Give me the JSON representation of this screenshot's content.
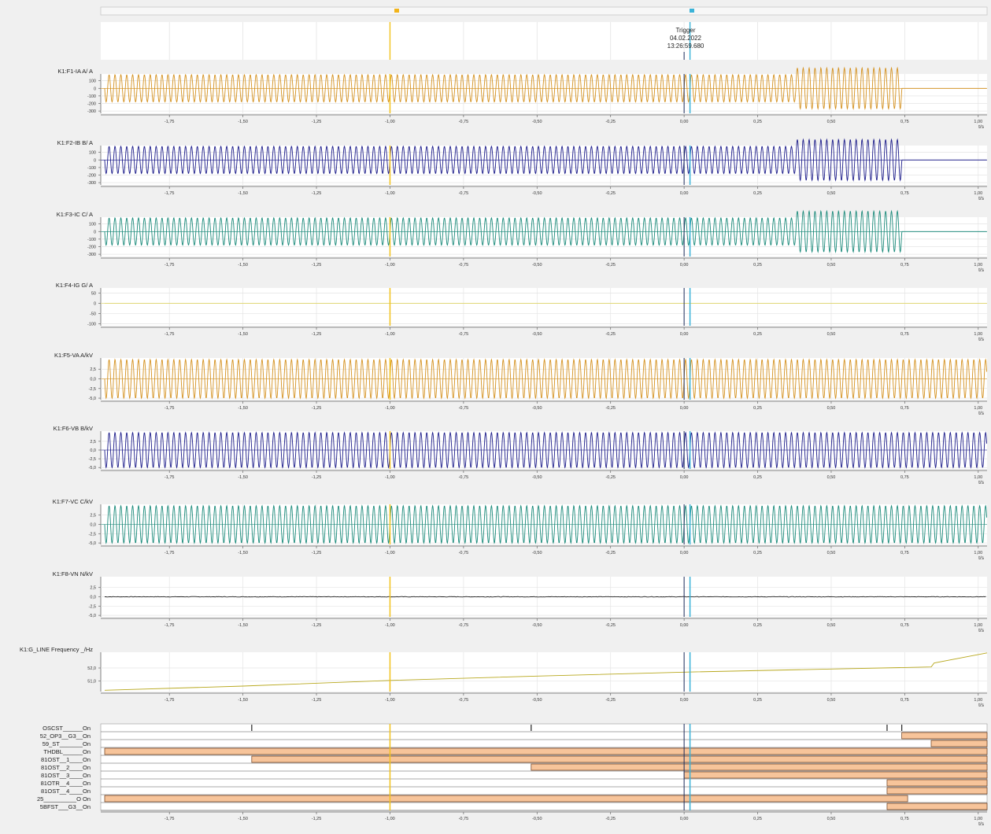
{
  "trigger": {
    "title": "Trigger",
    "date": "04.02.2022",
    "time": "13:26:59.680"
  },
  "colors": {
    "cursor_a": "#f2c21b",
    "cursor_b": "#3bb3d8",
    "trigger_line": "#1a2a5a",
    "phase_a": "#d4911f",
    "phase_b": "#1c1c8a",
    "phase_c": "#1a8a7a",
    "ground": "#e0d770",
    "neutral": "#222222",
    "frequency": "#b8a81e",
    "digital_on": "#f7c49a",
    "grid": "#e4e4e4"
  },
  "time_axis": {
    "unit": "t/s",
    "xlim": [
      -1.97,
      1.03
    ],
    "ticks": [
      -1.75,
      -1.5,
      -1.25,
      -1.0,
      -0.75,
      -0.5,
      -0.25,
      0.0,
      0.25,
      0.5,
      0.75,
      1.0
    ],
    "tick_labels": [
      "-1,75",
      "-1,50",
      "-1,25",
      "-1,00",
      "-0,75",
      "-0,50",
      "-0,25",
      "0,00",
      "0,25",
      "0,50",
      "0,75",
      "1,00"
    ],
    "cursor_a_t": -1.0,
    "cursor_b_t": 0.02,
    "trigger_t": 0.0
  },
  "chart_data": [
    {
      "type": "line",
      "title": "K1:F1-IA A/ A",
      "ytick_labels": [
        "100",
        "0",
        "-100",
        "-200",
        "-300"
      ],
      "yticks": [
        100,
        0,
        -100,
        -200,
        -300
      ],
      "ylim": [
        -330,
        190
      ],
      "color": "phase_a",
      "waveform": {
        "kind": "sine",
        "freq_hz": 50,
        "segments": [
          {
            "t_start": -1.97,
            "t_end": 0.38,
            "amplitude": 180
          },
          {
            "t_start": 0.38,
            "t_end": 0.74,
            "amplitude": 270
          },
          {
            "t_start": 0.74,
            "t_end": 1.03,
            "amplitude": 0
          }
        ]
      }
    },
    {
      "type": "line",
      "title": "K1:F2-IB B/ A",
      "ytick_labels": [
        "100",
        "0",
        "-100",
        "-200",
        "-300"
      ],
      "yticks": [
        100,
        0,
        -100,
        -200,
        -300
      ],
      "ylim": [
        -330,
        190
      ],
      "color": "phase_b",
      "waveform": {
        "kind": "sine",
        "freq_hz": 50,
        "segments": [
          {
            "t_start": -1.97,
            "t_end": 0.38,
            "amplitude": 180
          },
          {
            "t_start": 0.38,
            "t_end": 0.74,
            "amplitude": 270
          },
          {
            "t_start": 0.74,
            "t_end": 1.03,
            "amplitude": 0
          }
        ]
      }
    },
    {
      "type": "line",
      "title": "K1:F3-IC C/ A",
      "ytick_labels": [
        "100",
        "0",
        "-100",
        "-200",
        "-300"
      ],
      "yticks": [
        100,
        0,
        -100,
        -200,
        -300
      ],
      "ylim": [
        -330,
        190
      ],
      "color": "phase_c",
      "waveform": {
        "kind": "sine",
        "freq_hz": 50,
        "segments": [
          {
            "t_start": -1.97,
            "t_end": 0.38,
            "amplitude": 180
          },
          {
            "t_start": 0.38,
            "t_end": 0.74,
            "amplitude": 270
          },
          {
            "t_start": 0.74,
            "t_end": 1.03,
            "amplitude": 0
          }
        ]
      }
    },
    {
      "type": "line",
      "title": "K1:F4-IG G/ A",
      "ytick_labels": [
        "50",
        "0",
        "-50",
        "-100"
      ],
      "yticks": [
        50,
        0,
        -50,
        -100
      ],
      "ylim": [
        -110,
        75
      ],
      "color": "ground",
      "waveform": {
        "kind": "flat",
        "value": 0
      }
    },
    {
      "type": "line",
      "title": "K1:F5-VA A/kV",
      "ytick_labels": [
        "2,5",
        "0,0",
        "-2,5",
        "-5,0"
      ],
      "yticks": [
        2.5,
        0,
        -2.5,
        -5.0
      ],
      "ylim": [
        -5.4,
        5.4
      ],
      "color": "phase_a",
      "waveform": {
        "kind": "sine",
        "freq_hz": 50,
        "segments": [
          {
            "t_start": -1.97,
            "t_end": 1.03,
            "amplitude": 5.0
          }
        ]
      }
    },
    {
      "type": "line",
      "title": "K1:F6-VB B/kV",
      "ytick_labels": [
        "2,5",
        "0,0",
        "-2,5",
        "-5,0"
      ],
      "yticks": [
        2.5,
        0,
        -2.5,
        -5.0
      ],
      "ylim": [
        -5.4,
        5.4
      ],
      "color": "phase_b",
      "waveform": {
        "kind": "sine",
        "freq_hz": 50,
        "segments": [
          {
            "t_start": -1.97,
            "t_end": 1.03,
            "amplitude": 5.0
          }
        ]
      }
    },
    {
      "type": "line",
      "title": "K1:F7-VC C/kV",
      "ytick_labels": [
        "2,5",
        "0,0",
        "-2,5",
        "-5,0"
      ],
      "yticks": [
        2.5,
        0,
        -2.5,
        -5.0
      ],
      "ylim": [
        -5.4,
        5.4
      ],
      "color": "phase_c",
      "waveform": {
        "kind": "sine",
        "freq_hz": 50,
        "segments": [
          {
            "t_start": -1.97,
            "t_end": 1.03,
            "amplitude": 5.0
          }
        ]
      }
    },
    {
      "type": "line",
      "title": "K1:F8-VN N/kV",
      "ytick_labels": [
        "2,5",
        "0,0",
        "-2,5",
        "-5,0"
      ],
      "yticks": [
        2.5,
        0,
        -2.5,
        -5.0
      ],
      "ylim": [
        -5.4,
        5.4
      ],
      "color": "neutral",
      "waveform": {
        "kind": "noise",
        "value": 0,
        "amplitude": 0.15
      }
    },
    {
      "type": "line",
      "title": "K1:G_LINE Frequency _/Hz",
      "ytick_labels": [
        "52,0",
        "51,0"
      ],
      "yticks": [
        52.0,
        51.0
      ],
      "ylim": [
        50.2,
        53.2
      ],
      "color": "frequency",
      "x": [
        -1.97,
        -1.5,
        -1.0,
        -0.5,
        0.0,
        0.5,
        0.84,
        0.85,
        1.03
      ],
      "y": [
        50.3,
        50.62,
        51.05,
        51.38,
        51.68,
        51.92,
        52.08,
        52.38,
        53.15
      ]
    },
    {
      "type": "timeline",
      "title": "",
      "color": "digital_on",
      "series": [
        {
          "name": "OSCST______On",
          "intervals": [],
          "marks": [
            -1.47,
            -0.52,
            0.69,
            0.74
          ]
        },
        {
          "name": "52_OP3__G3__On",
          "intervals": [
            [
              0.74,
              1.03
            ]
          ]
        },
        {
          "name": "59_ST_______On",
          "intervals": [
            [
              0.84,
              1.03
            ]
          ]
        },
        {
          "name": "THDBL______On",
          "intervals": [
            [
              -1.97,
              1.03
            ]
          ]
        },
        {
          "name": "81OST__1____On",
          "intervals": [
            [
              -1.47,
              1.03
            ]
          ]
        },
        {
          "name": "81OST__2____On",
          "intervals": [
            [
              -0.52,
              1.03
            ]
          ]
        },
        {
          "name": "81OST__3____On",
          "intervals": [
            [
              0.0,
              1.03
            ]
          ]
        },
        {
          "name": "81OTR__4____On",
          "intervals": [
            [
              0.69,
              1.03
            ]
          ]
        },
        {
          "name": "81OST__4____On",
          "intervals": [
            [
              0.69,
              1.03
            ]
          ]
        },
        {
          "name": "25__________O On",
          "intervals": [
            [
              -1.97,
              0.76
            ]
          ]
        },
        {
          "name": "5BFST___G3__On",
          "intervals": [
            [
              0.69,
              1.03
            ]
          ]
        }
      ]
    }
  ]
}
